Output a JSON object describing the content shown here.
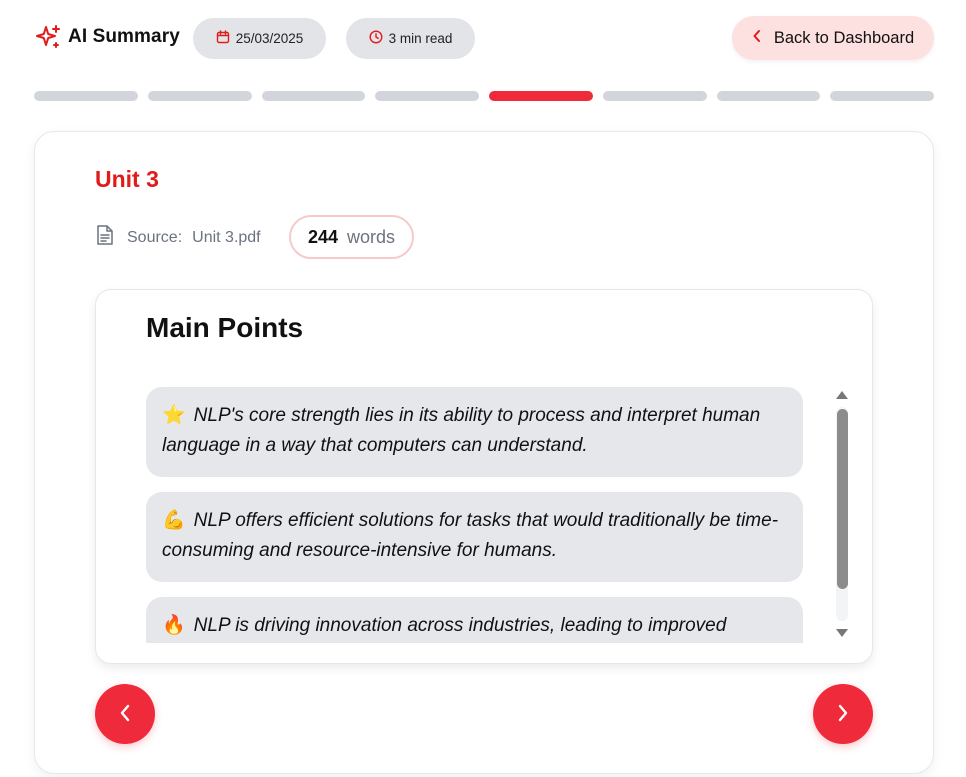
{
  "header": {
    "brand_title": "AI Summary",
    "brand_icon": "sparkle-icon",
    "date": "25/03/2025",
    "date_icon": "calendar-icon",
    "read_time": "3 min read",
    "read_icon": "clock-icon",
    "back_label": "Back to Dashboard",
    "back_icon": "chevron-left-icon"
  },
  "progress": {
    "total_steps": 8,
    "current_step": 5,
    "active_color": "#ef2a3b",
    "inactive_color": "#d2d5db"
  },
  "card": {
    "unit_title": "Unit 3",
    "source_label": "Source:",
    "source_file": "Unit 3.pdf",
    "word_count": "244",
    "word_label": "words",
    "section_title": "Main Points",
    "points": [
      {
        "emoji": "⭐",
        "text": "NLP's core strength lies in its ability to process and interpret human language in a way that computers can understand."
      },
      {
        "emoji": "💪",
        "text": "NLP offers efficient solutions for tasks that would traditionally be time-consuming and resource-intensive for humans."
      },
      {
        "emoji": "🔥",
        "text": "NLP is driving innovation across industries, leading to improved"
      }
    ]
  },
  "colors": {
    "accent": "#ef2a3b",
    "title_red": "#e11a1a",
    "back_button_bg": "#fde0e0",
    "pill_bg": "#e3e4e8",
    "point_bg": "#e5e7eb"
  }
}
